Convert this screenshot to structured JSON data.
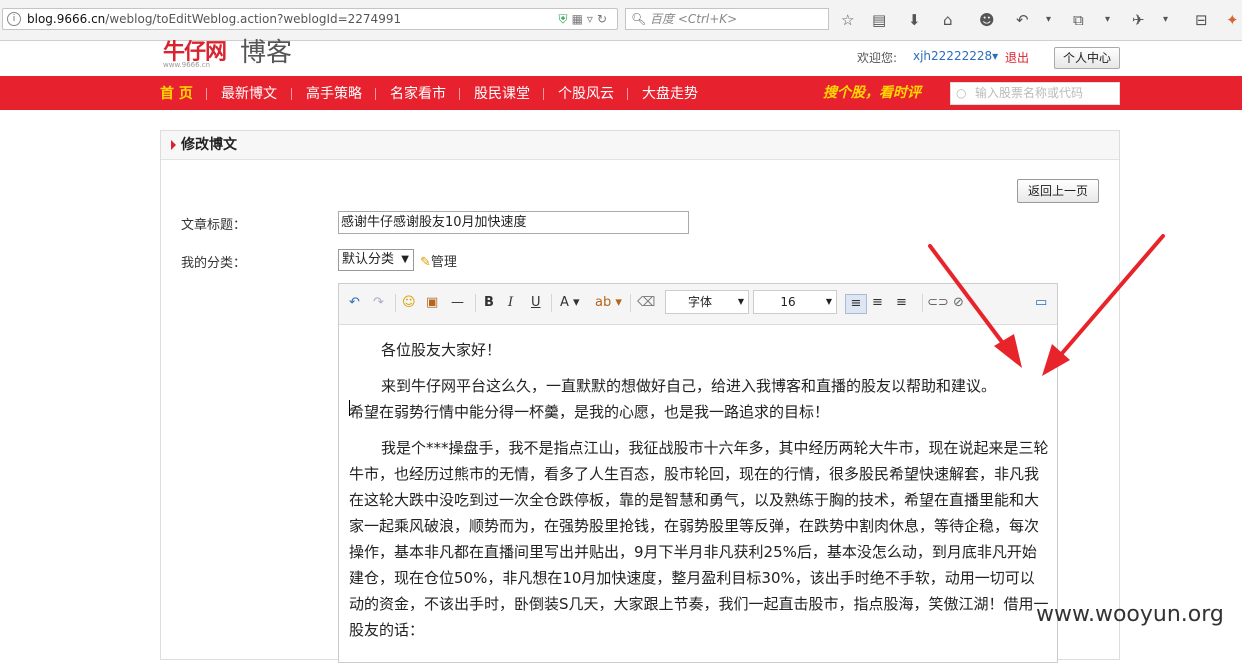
{
  "browser": {
    "url_host": "blog.9666.cn",
    "url_path": "/weblog/toEditWeblog.action?weblogId=2274991",
    "search_placeholder": "百度 <Ctrl+K>"
  },
  "site": {
    "logo_text": "牛仔网",
    "logo_domain": "www.9666.cn",
    "section_name": "博客",
    "welcome_label": "欢迎您:",
    "username": "xjh22222228▾",
    "logout_label": "退出",
    "user_center_label": "个人中心"
  },
  "nav": {
    "items": [
      "首 页",
      "最新博文",
      "高手策略",
      "名家看市",
      "股民课堂",
      "个股风云",
      "大盘走势"
    ],
    "slogan": "搜个股，看时评",
    "stock_search_placeholder": "输入股票名称或代码"
  },
  "panel": {
    "title": "修改博文",
    "back_label": "返回上一页",
    "title_label": "文章标题：",
    "title_value": "感谢牛仔感谢股友10月加快速度",
    "category_label": "我的分类：",
    "category_value": "默认分类",
    "manage_label": "管理"
  },
  "editor": {
    "font_family": "字体",
    "font_size": "16",
    "content": {
      "greeting": "各位股友大家好！",
      "p1_a": "来到牛仔网平台这么久，一直默默的想做好自己，给进入我博客和直播的股友以帮助和建议。",
      "p1_b": "希望在弱势行情中能分得一杯羹，是我的心愿，也是我一路追求的目标！",
      "p2": "我是个***操盘手，我不是指点江山，我征战股市十六年多，其中经历两轮大牛市，现在说起来是三轮牛市，也经历过熊市的无情，看多了人生百态，股市轮回，现在的行情，很多股民希望快速解套，非凡我在这轮大跌中没吃到过一次全仓跌停板，靠的是智慧和勇气，以及熟练于胸的技术，希望在直播里能和大家一起乘风破浪，顺势而为，在强势股里抢钱，在弱势股里等反弹，在跌势中割肉休息，等待企稳，每次操作，基本非凡都在直播间里写出并贴出，9月下半月非凡获利25%后，基本没怎么动，到月底非凡开始建仓，现在仓位50%，非凡想在10月加快速度，整月盈利目标30%，该出手时绝不手软，动用一切可以动的资金，不该出手时，卧倒装S几天，大家跟上节奏，我们一起直击股市，指点股海，笑傲江湖！借用一股友的话："
    }
  },
  "colors": {
    "brand_red": "#e8212e",
    "nav_highlight": "#ffd800",
    "annotation_red": "#e8242b"
  },
  "watermark": "www.wooyun.org"
}
